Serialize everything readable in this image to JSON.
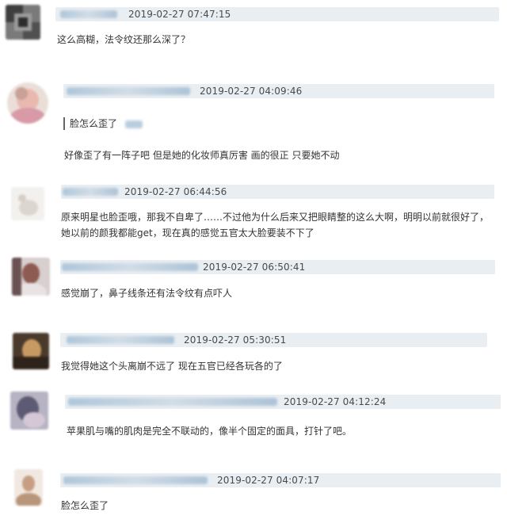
{
  "comments": [
    {
      "timestamp": "2019-02-27 07:47:15",
      "text": "这么高糊，法令纹还那么深了？"
    },
    {
      "timestamp": "2019-02-27 04:09:46",
      "quote": "脸怎么歪了",
      "text": "好像歪了有一阵子吧 但是她的化妆师真厉害 画的很正 只要她不动"
    },
    {
      "timestamp": "2019-02-27 06:44:56",
      "text": "原来明星也脸歪哦，那我不自卑了……不过他为什么后来又把眼睛整的这么大啊，明明以前就很好了，她以前的颜我都能get，现在真的感觉五官太大脸要装不下了"
    },
    {
      "timestamp": "2019-02-27 06:50:41",
      "text": "感觉崩了，鼻子线条还有法令纹有点吓人"
    },
    {
      "timestamp": "2019-02-27 05:30:51",
      "text": "我觉得她这个头离崩不远了 现在五官已经各玩各的了"
    },
    {
      "timestamp": "2019-02-27 04:12:24",
      "text": "苹果肌与嘴的肌肉是完全不联动的，像半个固定的面具，打针了吧。"
    },
    {
      "timestamp": "2019-02-27 04:07:17",
      "text": "脸怎么歪了"
    }
  ]
}
